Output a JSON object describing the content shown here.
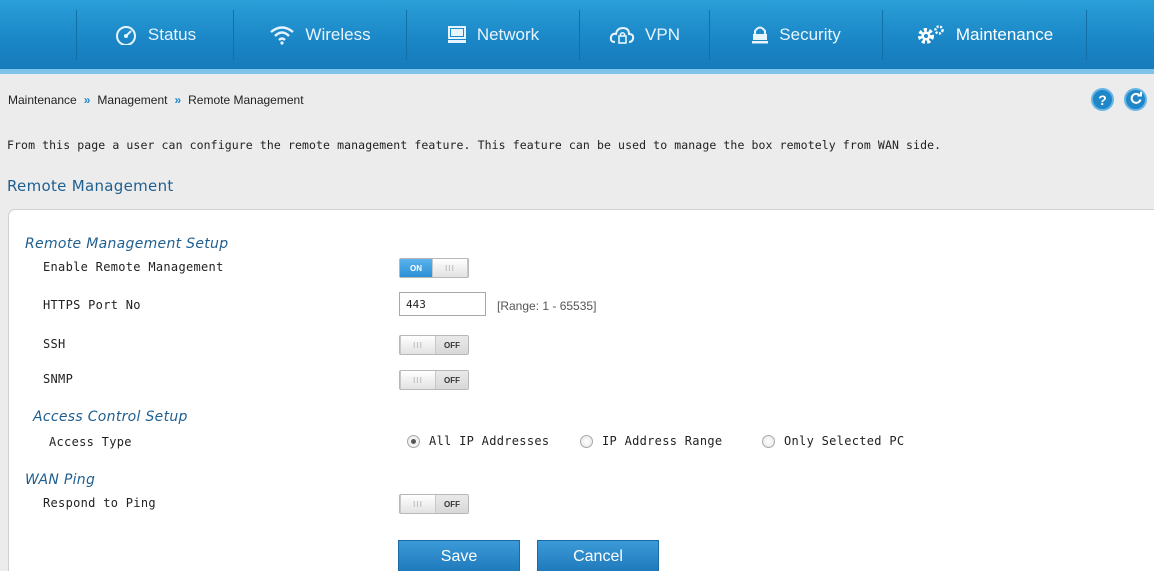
{
  "nav": {
    "items": [
      {
        "label": "Status",
        "icon": "gauge-icon"
      },
      {
        "label": "Wireless",
        "icon": "wifi-icon"
      },
      {
        "label": "Network",
        "icon": "monitor-icon"
      },
      {
        "label": "VPN",
        "icon": "cloud-lock-icon"
      },
      {
        "label": "Security",
        "icon": "lock-icon"
      },
      {
        "label": "Maintenance",
        "icon": "gears-icon",
        "active": true
      }
    ]
  },
  "breadcrumb": [
    "Maintenance",
    "Management",
    "Remote Management"
  ],
  "breadcrumb_sep": "»",
  "help_label": "?",
  "description": "From this page a user can configure the remote management feature. This feature can be used to manage the box remotely from WAN side.",
  "page_title": "Remote Management",
  "setup": {
    "title": "Remote Management Setup",
    "enable_label": "Enable Remote Management",
    "enable_state": "ON",
    "https_label": "HTTPS Port No",
    "https_value": "443",
    "https_hint": "[Range: 1 - 65535]",
    "ssh_label": "SSH",
    "ssh_state": "OFF",
    "snmp_label": "SNMP",
    "snmp_state": "OFF"
  },
  "access": {
    "title": "Access Control Setup",
    "type_label": "Access Type",
    "options": [
      "All IP Addresses",
      "IP Address Range",
      "Only Selected PC"
    ],
    "selected": "All IP Addresses"
  },
  "wan_ping": {
    "title": "WAN Ping",
    "respond_label": "Respond to Ping",
    "respond_state": "OFF"
  },
  "toggle_grip": "III",
  "buttons": {
    "save": "Save",
    "cancel": "Cancel"
  },
  "colors": {
    "accent": "#1f86c8",
    "nav_bg": "#1a86c6",
    "heading": "#1f5f90"
  }
}
